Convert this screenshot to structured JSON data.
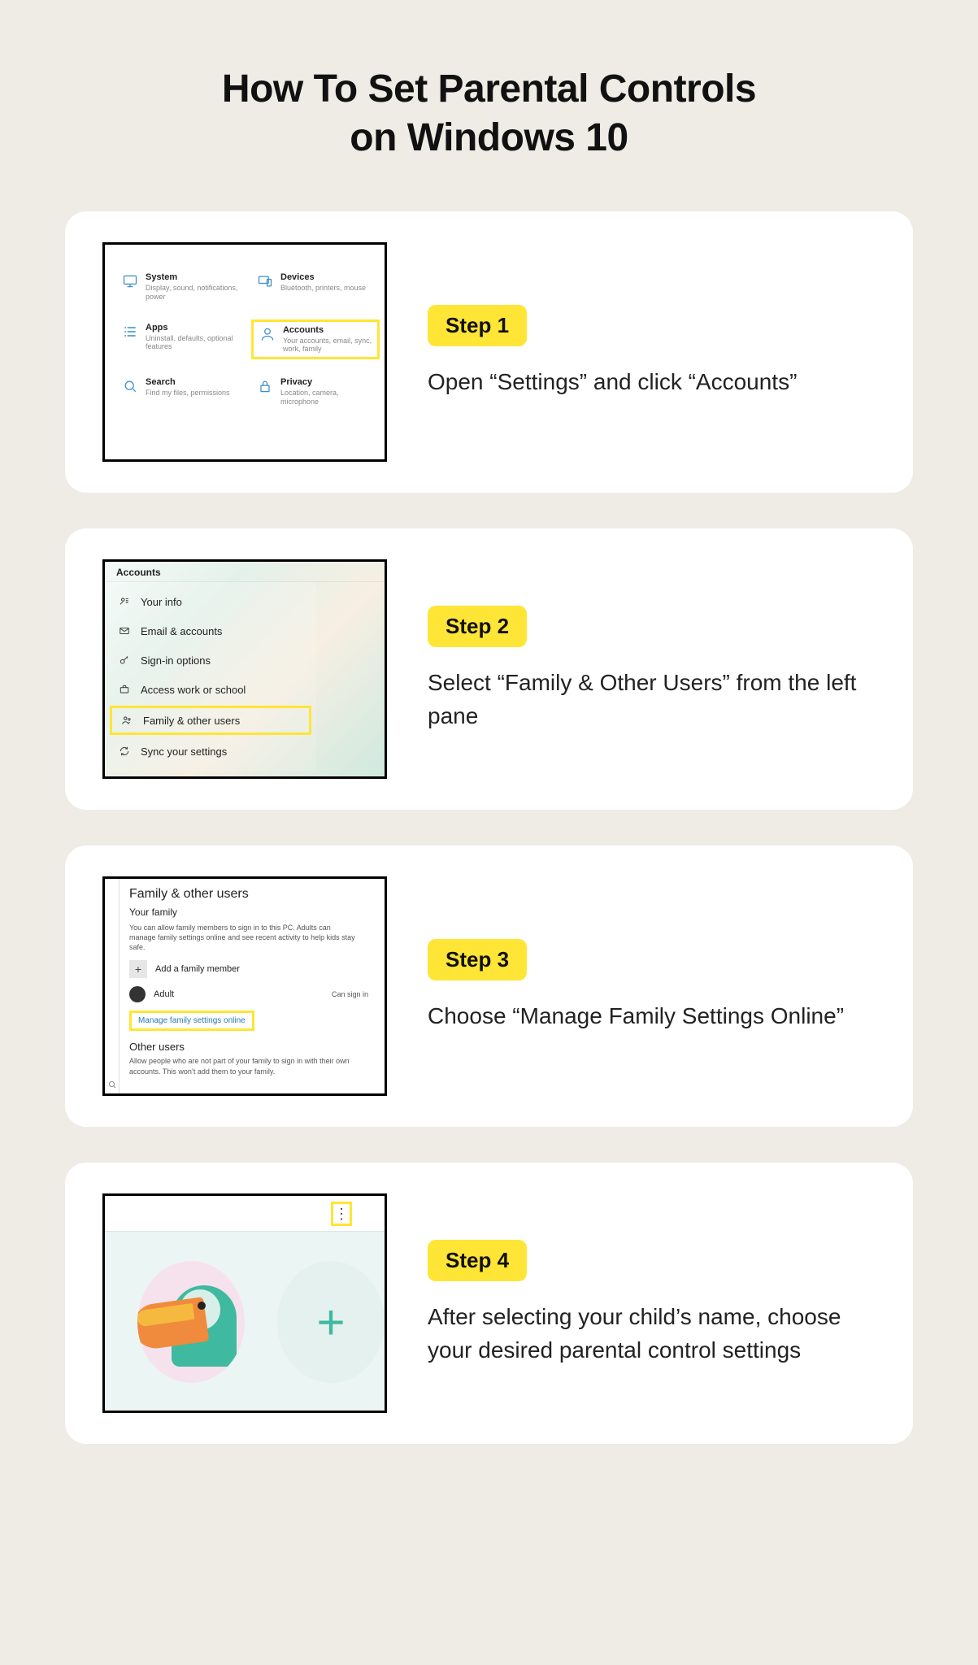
{
  "title_line1": "How To Set Parental Controls",
  "title_line2": "on Windows 10",
  "steps": [
    {
      "badge": "Step 1",
      "text": "Open “Settings” and click “Accounts”"
    },
    {
      "badge": "Step 2",
      "text": "Select “Family & Other Users” from the left pane"
    },
    {
      "badge": "Step 3",
      "text": "Choose “Manage Family Settings Online”"
    },
    {
      "badge": "Step 4",
      "text": "After selecting your child’s name, choose your desired parental control settings"
    }
  ],
  "step1_tiles": {
    "system": {
      "label": "System",
      "sub": "Display, sound, notifications, power"
    },
    "devices": {
      "label": "Devices",
      "sub": "Bluetooth, printers, mouse"
    },
    "apps": {
      "label": "Apps",
      "sub": "Uninstall, defaults, optional features"
    },
    "accounts": {
      "label": "Accounts",
      "sub": "Your accounts, email, sync, work, family"
    },
    "search": {
      "label": "Search",
      "sub": "Find my files, permissions"
    },
    "privacy": {
      "label": "Privacy",
      "sub": "Location, camera, microphone"
    }
  },
  "step2": {
    "header": "Accounts",
    "items": [
      "Your info",
      "Email & accounts",
      "Sign-in options",
      "Access work or school",
      "Family & other users",
      "Sync your settings"
    ]
  },
  "step3": {
    "heading": "Family & other users",
    "sub": "Your family",
    "intro": "You can allow family members to sign in to this PC. Adults can manage family settings online and see recent activity to help kids stay safe.",
    "add": "Add a family member",
    "member_label": "Adult",
    "member_status": "Can sign in",
    "link": "Manage family settings online",
    "other_heading": "Other users",
    "other_text": "Allow people who are not part of your family to sign in with their own accounts. This won’t add them to your family."
  },
  "step4": {
    "dots": "⋮"
  }
}
